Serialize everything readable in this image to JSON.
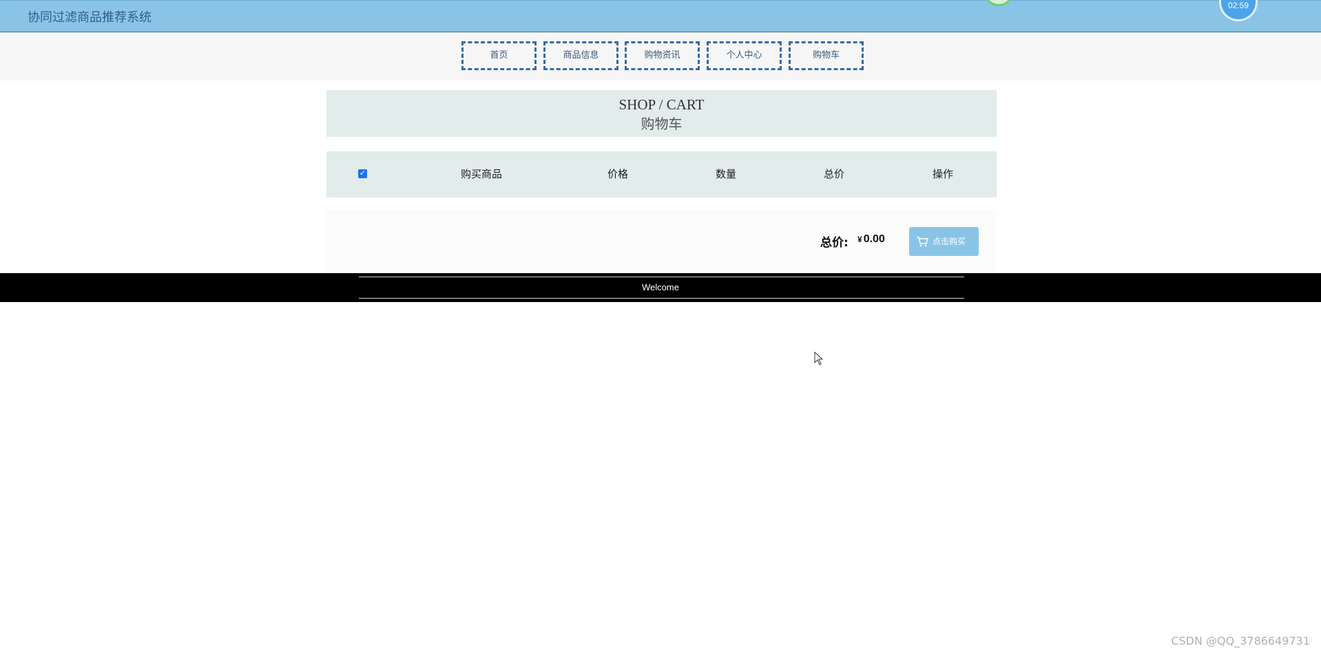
{
  "header": {
    "site_title": "协同过滤商品推荐系统",
    "clock_time": "02:59"
  },
  "nav": {
    "items": [
      {
        "label": "首页"
      },
      {
        "label": "商品信息"
      },
      {
        "label": "购物资讯"
      },
      {
        "label": "个人中心"
      },
      {
        "label": "购物车"
      }
    ]
  },
  "section": {
    "title_en": "SHOP / CART",
    "title_cn": "购物车"
  },
  "cart": {
    "select_all_checked": true,
    "columns": [
      "购买商品",
      "价格",
      "数量",
      "总价",
      "操作"
    ],
    "rows": []
  },
  "summary": {
    "total_label": "总价:",
    "currency": "¥",
    "total_value": "0.00",
    "buy_label": "点击购买"
  },
  "footer": {
    "text": "Welcome"
  },
  "watermark": "CSDN @QQ_3786649731",
  "colors": {
    "topbar": "#89c4e6",
    "accent_text": "#2f5f8f",
    "panel": "#e1eceb",
    "footer": "#000000",
    "checkbox": "#1a73e8"
  }
}
